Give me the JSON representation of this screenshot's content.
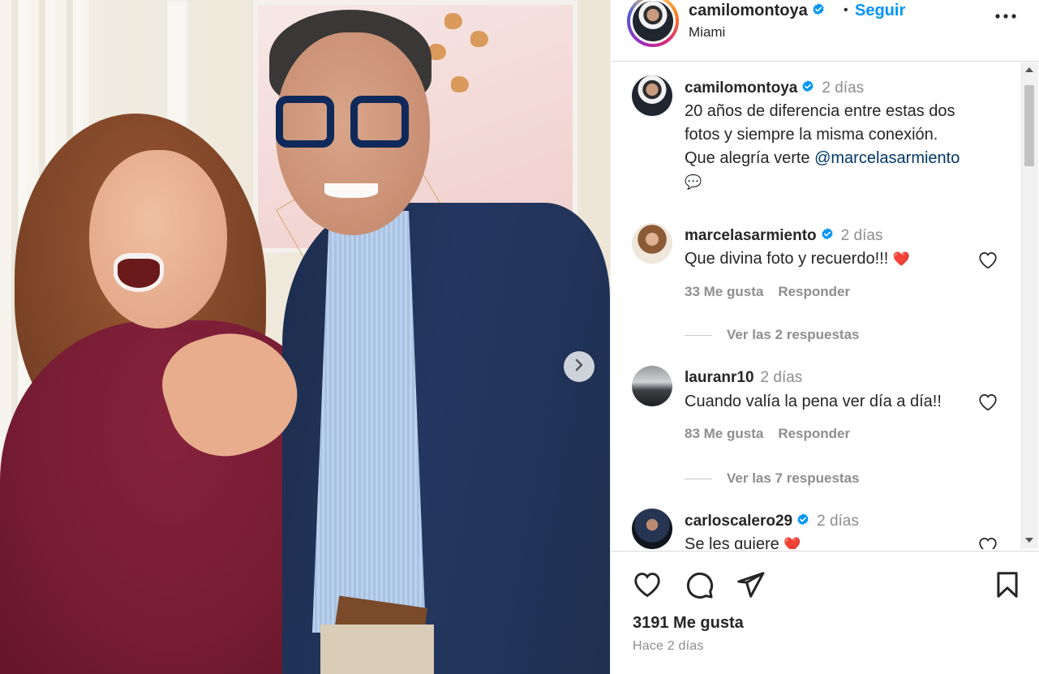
{
  "post": {
    "author": "camilomontoya",
    "location": "Miami",
    "follow_label": "Seguir",
    "separator": "•",
    "caption": {
      "time": "2 días",
      "line1": "20 años de diferencia entre estas dos",
      "line2": "fotos y siempre la misma conexión.",
      "line3_text": "Que alegría verte ",
      "line3_mention": "@marcelasarmiento",
      "emoji": "💬"
    },
    "likes_label": "3191 Me gusta",
    "time_ago": "Hace 2 días"
  },
  "comments": [
    {
      "user": "marcelasarmiento",
      "verified": true,
      "time": "2 días",
      "text": "Que divina foto y recuerdo!!! ",
      "emoji": "❤️",
      "likes": "33 Me gusta",
      "reply_label": "Responder",
      "view_replies": "Ver las 2 respuestas"
    },
    {
      "user": "lauranr10",
      "verified": false,
      "time": "2 días",
      "text": "Cuando valía la pena ver día a día!!",
      "likes": "83 Me gusta",
      "reply_label": "Responder",
      "view_replies": "Ver las 7 respuestas"
    },
    {
      "user": "carloscalero29",
      "verified": true,
      "time": "2 días",
      "text": "Se les quiere ",
      "emoji": "❤️"
    }
  ],
  "icons": {
    "verified": "verified-badge-icon",
    "more": "more-options-icon",
    "like": "heart-icon",
    "comment": "comment-icon",
    "share": "send-icon",
    "save": "bookmark-icon",
    "carousel_next": "chevron-right-icon"
  },
  "colors": {
    "accent": "#0095f6",
    "verified": "#0095f6",
    "mention": "#00376b",
    "heart": "#ed4956",
    "muted": "#8e8e8e"
  }
}
